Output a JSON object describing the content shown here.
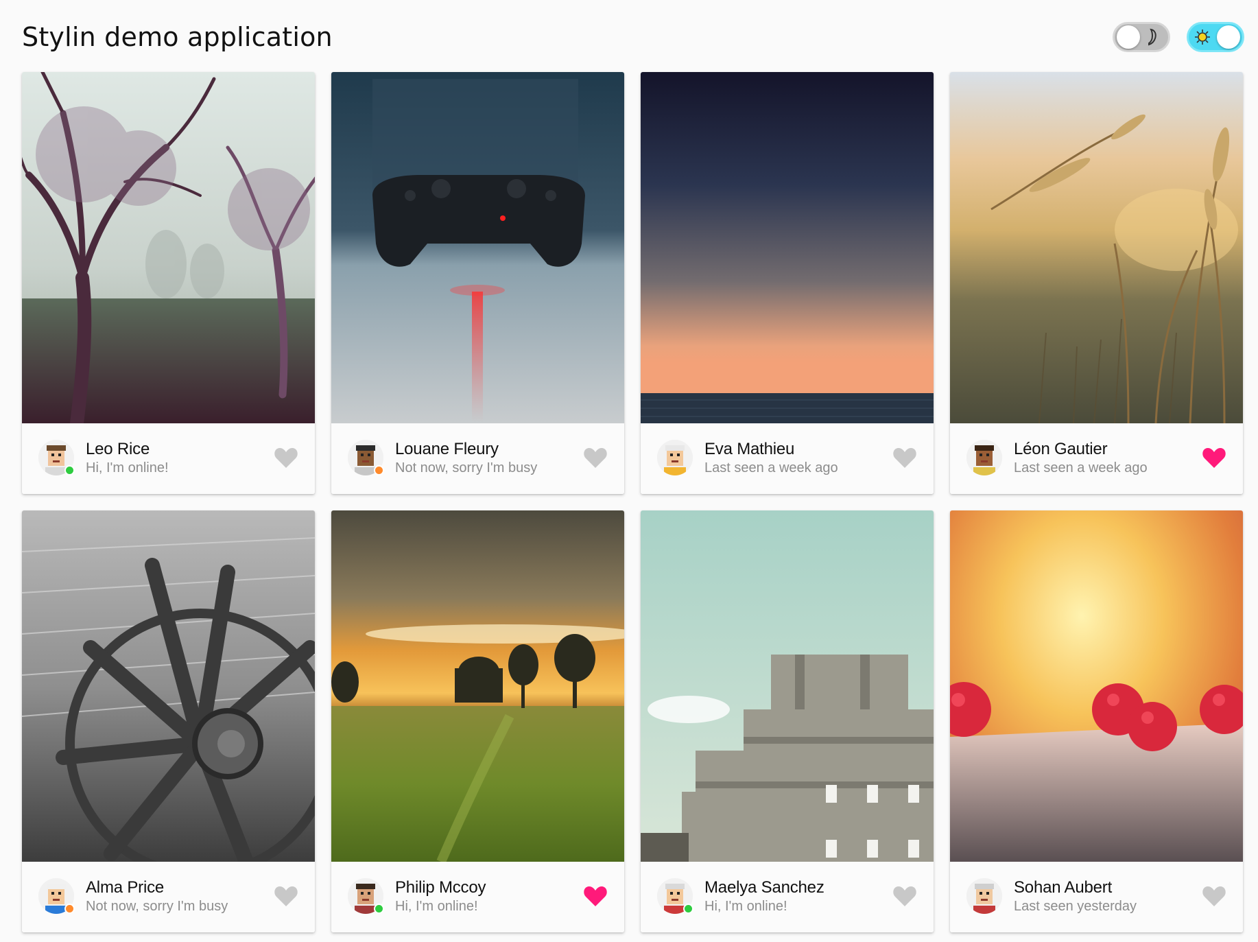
{
  "app": {
    "title": "Stylin demo application"
  },
  "theme_toggles": [
    {
      "name": "dark-mode-toggle",
      "icon": "moon-icon",
      "state": "off",
      "color": "#bdbdbd"
    },
    {
      "name": "light-mode-toggle",
      "icon": "sun-icon",
      "state": "on",
      "color": "#4dd9f2"
    }
  ],
  "colors": {
    "liked": "#ff1a7a",
    "unliked": "#c8c8c8",
    "online": "#2ecc40",
    "busy": "#ff8a2b"
  },
  "cards": [
    {
      "name": "Leo Rice",
      "status": "Hi, I'm online!",
      "presence": "online",
      "liked": false,
      "image": "foggy-trees"
    },
    {
      "name": "Louane Fleury",
      "status": "Not now, sorry I'm busy",
      "presence": "busy",
      "liked": false,
      "image": "game-controller"
    },
    {
      "name": "Eva Mathieu",
      "status": "Last seen a week ago",
      "presence": "none",
      "liked": false,
      "image": "sunset-sea"
    },
    {
      "name": "Léon Gautier",
      "status": "Last seen a week ago",
      "presence": "none",
      "liked": true,
      "image": "wheat-field"
    },
    {
      "name": "Alma Price",
      "status": "Not now, sorry I'm busy",
      "presence": "busy",
      "liked": false,
      "image": "wagon-wheel"
    },
    {
      "name": "Philip Mccoy",
      "status": "Hi, I'm online!",
      "presence": "online",
      "liked": true,
      "image": "sunset-field"
    },
    {
      "name": "Maelya Sanchez",
      "status": "Hi, I'm online!",
      "presence": "online",
      "liked": false,
      "image": "concrete-bunker"
    },
    {
      "name": "Sohan Aubert",
      "status": "Last seen yesterday",
      "presence": "none",
      "liked": false,
      "image": "raspberries"
    }
  ]
}
